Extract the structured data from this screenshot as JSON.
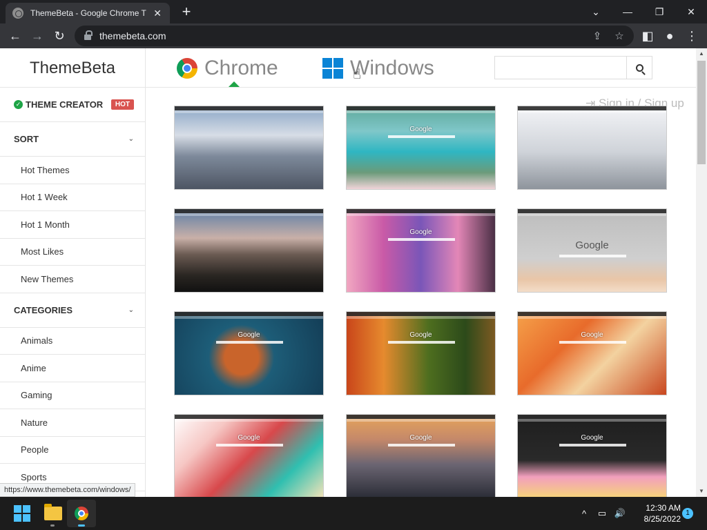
{
  "browser": {
    "tab_title": "ThemeBeta - Google Chrome Themes",
    "tab_close": "✕",
    "new_tab": "+",
    "url": "themebeta.com",
    "controls": {
      "tablist": "⌄",
      "minimize": "—",
      "restore": "❐",
      "close": "✕"
    },
    "nav": {
      "back": "←",
      "forward": "→",
      "reload": "↻",
      "share": "⇪",
      "bookmark": "☆",
      "sidepanel": "◧",
      "profile": "●",
      "menu": "⋮"
    }
  },
  "site": {
    "logo": "ThemeBeta",
    "nav_chrome": "Chrome",
    "nav_windows": "Windows",
    "search_placeholder": "",
    "signin": "Sign in / Sign up",
    "sign_icon": "⇥",
    "status_url": "https://www.themebeta.com/windows/"
  },
  "sidebar": {
    "creator_label": "THEME CREATOR",
    "creator_icon": "✓",
    "hot_badge": "HOT",
    "sort_header": "SORT",
    "sort_items": [
      "Hot Themes",
      "Hot 1 Week",
      "Hot 1 Month",
      "Most Likes",
      "New Themes"
    ],
    "categories_header": "CATEGORIES",
    "categories": [
      "Animals",
      "Anime",
      "Gaming",
      "Nature",
      "People",
      "Sports"
    ],
    "chevron": "⌄"
  },
  "themes": [
    {
      "google": "",
      "bg": "linear-gradient(180deg,#8aa6c6 0%,#d7dde6 35%,#7e8a9b 60%,#4d5563 100%)"
    },
    {
      "google": "Google",
      "bg": "linear-gradient(180deg,#5fa89a 0%,#7fc7c9 30%,#2fb6c2 55%,#6b9b7a 80%,#f0d4d9 100%)"
    },
    {
      "google": "",
      "bg": "linear-gradient(180deg,#f3f4f7 0%,#cfd3d9 55%,#8e949c 100%)"
    },
    {
      "google": "",
      "bg": "linear-gradient(180deg,#5f7fa6 0%,#c9b0a8 35%,#6a5a52 55%,#2a2622 80%,#111 100%)"
    },
    {
      "google": "Google",
      "bg": "linear-gradient(90deg,#f1a7c1 0%,#c95aa7 25%,#7a56b8 50%,#e387b7 75%,#4a2f45 100%)"
    },
    {
      "google": "Google",
      "bg": "linear-gradient(180deg,#bdbdbd 0%,#cfcfcf 60%,#e9c6a7 85%,#f3ddc9 100%)"
    },
    {
      "google": "Google",
      "bg": "radial-gradient(circle at 45% 55%,#c9642b 0 18%,#1d5d78 35%,#133c55 100%)"
    },
    {
      "google": "Google",
      "bg": "linear-gradient(90deg,#c9461a 0%,#e68a2e 25%,#4e6e1f 55%,#2c4a1a 80%,#7d5a22 100%)"
    },
    {
      "google": "Google",
      "bg": "linear-gradient(135deg,#f5a14a 0%,#e86b2b 35%,#f3d2a0 60%,#c9471f 100%)"
    },
    {
      "google": "Google",
      "bg": "linear-gradient(135deg,#ffffff 0%,#f6c7c4 25%,#d8484b 50%,#2fbfb0 75%,#f2e3b8 100%)"
    },
    {
      "google": "Google",
      "bg": "linear-gradient(180deg,#e6a45a 0%,#c4886a 30%,#6b6572 60%,#2b2d37 100%)"
    },
    {
      "google": "Google",
      "bg": "linear-gradient(180deg,#1e1e1e 0%,#2a2a2a 55%,#f29fbd 75%,#f6d37a 100%)"
    }
  ],
  "taskbar": {
    "time": "12:30 AM",
    "date": "8/25/2022",
    "notifications": "1",
    "tray_up": "^",
    "tray_net": "▭",
    "tray_vol": "🔊"
  }
}
